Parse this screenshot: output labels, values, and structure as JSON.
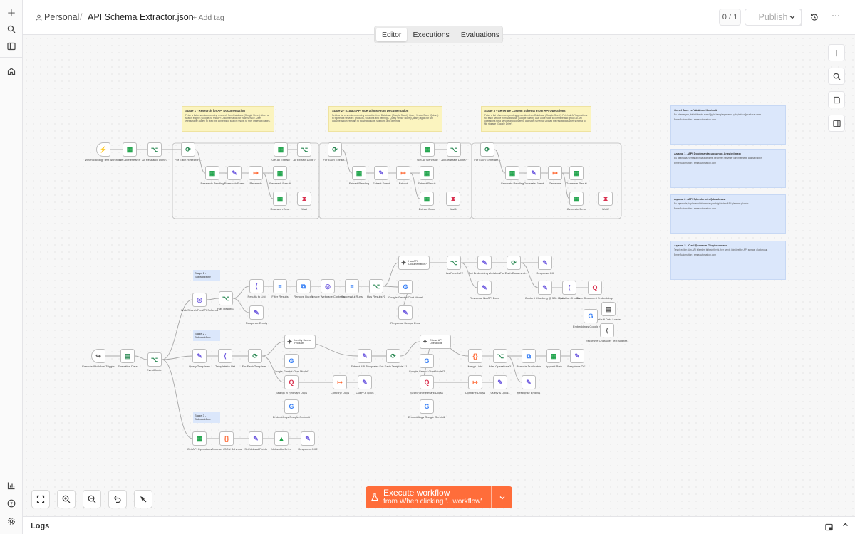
{
  "breadcrumb": {
    "workspace": "Personal",
    "separator": "/",
    "workflow_name": "API Schema Extractor.json",
    "add_tag": "+ Add tag"
  },
  "header": {
    "counter_left": "0",
    "counter_right": "1",
    "counter_text": "0 / 1",
    "publish": "Publish"
  },
  "tabs": [
    {
      "label": "Editor",
      "active": true
    },
    {
      "label": "Executions",
      "active": false
    },
    {
      "label": "Evaluations",
      "active": false
    }
  ],
  "execute": {
    "title": "Execute workflow",
    "subtitle": "from When clicking '...workflow'"
  },
  "logs": {
    "label": "Logs"
  },
  "colors": {
    "accent": "#ff6d3a",
    "sticky_yellow": "#fbf4bf",
    "sticky_blue": "#dbe7fb",
    "node_green": "#1ea34a",
    "node_purple": "#6f5be0",
    "node_red": "#d9304f"
  },
  "stickies": [
    {
      "title": "Stage 1 - Research for API Documentation",
      "text": "Fetch a list of services pending research from Database (Google Sheet). Uses a search engine (Google) to find API Documentation for each service. Uses Webscraper (Apify) to read the contents of search results to filter irrelevant pages."
    },
    {
      "title": "Stage 2 - Extract API Operations From Documentation",
      "text": "Fetch a list of services pending extraction from Database (Google Sheet). Query Vector Store (Qdrant) to figure out services' products, solutions and offerings. Query Vector Store (Qdrant) again for API documentation relevant to those products, solutions and offerings."
    },
    {
      "title": "Stage 3 - Generate Custom Schema From API Operations",
      "text": "Fetch a list of services pending generation from Database (Google Sheet). Fetch all API operations for each service from Database (Google Sheet). Use Code node to combine and group all API operations for a service and convert to a custom schema. Upload the resulting custom schema to file storage (Google Drive)."
    }
  ],
  "notes": [
    {
      "title": "Genel Akış ve Yürütme Kontrolü",
      "text": "Bu otomasyon, bir tetikleyici aracılığıyla hangi aşamanın çalıştırılacağına karar verir.",
      "link": "Emre Automation | emreautomation.com"
    },
    {
      "title": "Aşama 1 - API Dokümantasyonunun Araştırılması",
      "text": "Bu aşamada, veritabanında araştırma bekleyen servisler için internette arama yapılır.",
      "link": "Emre Automation | emreautomation.com"
    },
    {
      "title": "Aşama 2 - API İşlemlerinin Çıkarılması",
      "text": "Bu aşamada, toplanan dokümantasyon bilgisinden API işlemleri çıkarılır.",
      "link": "Emre Automation | emreautomation.com"
    },
    {
      "title": "Aşama 3 - Özel Şemanın Oluşturulması",
      "text": "Tespit edilen tüm API işlemleri birleştirilerek, her servis için özel bir API şeması oluşturulur.",
      "link": "Emre Automation | emreautomation.com"
    }
  ],
  "stage_labels": [
    "Stage 1 - Subworkflow",
    "Stage 2 - Subworkflow",
    "Stage 3 - Subworkflow"
  ],
  "nodes": [
    {
      "label": "When clicking 'Test workflow'",
      "icon": "⚡",
      "color": "#555"
    },
    {
      "label": "Get All Research",
      "icon": "▦",
      "color": "#1ea34a"
    },
    {
      "label": "All Research Done?",
      "icon": "⌥",
      "color": "#2c8a55"
    },
    {
      "label": "For Each Research...",
      "icon": "⟳",
      "color": "#2c8a55"
    },
    {
      "label": "Research Pending",
      "icon": "▦",
      "color": "#1ea34a"
    },
    {
      "label": "Research Event",
      "icon": "✎",
      "color": "#6f5be0"
    },
    {
      "label": "Research",
      "icon": "↦",
      "color": "#ff6d3a"
    },
    {
      "label": "Research Result",
      "icon": "▦",
      "color": "#1ea34a"
    },
    {
      "label": "Research Error",
      "icon": "▦",
      "color": "#1ea34a"
    },
    {
      "label": "Get All Extract",
      "icon": "▦",
      "color": "#1ea34a"
    },
    {
      "label": "All Extract Done?",
      "icon": "⌥",
      "color": "#2c8a55"
    },
    {
      "label": "Wait",
      "icon": "⧗",
      "color": "#d9304f"
    },
    {
      "label": "For Each Extract...",
      "icon": "⟳",
      "color": "#2c8a55"
    },
    {
      "label": "Extract Pending",
      "icon": "▦",
      "color": "#1ea34a"
    },
    {
      "label": "Extract Event",
      "icon": "✎",
      "color": "#6f5be0"
    },
    {
      "label": "Extract",
      "icon": "↦",
      "color": "#ff6d3a"
    },
    {
      "label": "Extract Result",
      "icon": "▦",
      "color": "#1ea34a"
    },
    {
      "label": "Extract Error",
      "icon": "▦",
      "color": "#1ea34a"
    },
    {
      "label": "Wait1",
      "icon": "⧗",
      "color": "#d9304f"
    },
    {
      "label": "Get All Generate",
      "icon": "▦",
      "color": "#1ea34a"
    },
    {
      "label": "All Generate Done?",
      "icon": "⌥",
      "color": "#2c8a55"
    },
    {
      "label": "For Each Generate...",
      "icon": "⟳",
      "color": "#2c8a55"
    },
    {
      "label": "Generate Pending",
      "icon": "▦",
      "color": "#1ea34a"
    },
    {
      "label": "Generate Event",
      "icon": "✎",
      "color": "#6f5be0"
    },
    {
      "label": "Generate",
      "icon": "↦",
      "color": "#ff6d3a"
    },
    {
      "label": "Generate Result",
      "icon": "▦",
      "color": "#1ea34a"
    },
    {
      "label": "Generate Error",
      "icon": "▦",
      "color": "#1ea34a"
    },
    {
      "label": "Wait2",
      "icon": "⧗",
      "color": "#d9304f"
    },
    {
      "label": "Execute Workflow Trigger",
      "icon": "↪",
      "color": "#444"
    },
    {
      "label": "Execution Data",
      "icon": "▤",
      "color": "#2c8a55"
    },
    {
      "label": "EventRouter",
      "icon": "⌥",
      "color": "#2c8a55"
    },
    {
      "label": "Web Search For API Schema",
      "icon": "◎",
      "color": "#6f5be0"
    },
    {
      "label": "Has Results?",
      "icon": "⌥",
      "color": "#2c8a55"
    },
    {
      "label": "Results to List",
      "icon": "⟨",
      "color": "#6f5be0"
    },
    {
      "label": "Filter Results",
      "icon": "≡",
      "color": "#3b82f6"
    },
    {
      "label": "Remove Dupes",
      "icon": "⧉",
      "color": "#3b82f6"
    },
    {
      "label": "Scrape Webpage Contents",
      "icon": "◎",
      "color": "#6f5be0"
    },
    {
      "label": "Successful Runs",
      "icon": "≡",
      "color": "#3b82f6"
    },
    {
      "label": "Has Results?1",
      "icon": "⌥",
      "color": "#2c8a55"
    },
    {
      "label": "Response Empty",
      "icon": "✎",
      "color": "#6f5be0"
    },
    {
      "label": "Has API Documentation?",
      "icon": "✦",
      "color": "#555"
    },
    {
      "label": "Google Gemini Chat Model",
      "icon": "G",
      "color": "#3b82f6"
    },
    {
      "label": "Response Scrape Error",
      "icon": "✎",
      "color": "#6f5be0"
    },
    {
      "label": "Has Results?2",
      "icon": "⌥",
      "color": "#2c8a55"
    },
    {
      "label": "Set Embedding Variables",
      "icon": "✎",
      "color": "#6f5be0"
    },
    {
      "label": "For Each Document...",
      "icon": "⟳",
      "color": "#2c8a55"
    },
    {
      "label": "Response OK",
      "icon": "✎",
      "color": "#6f5be0"
    },
    {
      "label": "Response No API Docs",
      "icon": "✎",
      "color": "#6f5be0"
    },
    {
      "label": "Content Chunking @ 50k Chars",
      "icon": "✎",
      "color": "#6f5be0"
    },
    {
      "label": "Split Out Chunks",
      "icon": "⟨",
      "color": "#6f5be0"
    },
    {
      "label": "Store Document Embeddings",
      "icon": "Q",
      "color": "#d9304f"
    },
    {
      "label": "Default Data Loader",
      "icon": "▤",
      "color": "#555"
    },
    {
      "label": "Embeddings Google Gemini",
      "icon": "G",
      "color": "#3b82f6"
    },
    {
      "label": "Recursive Character Text Splitter1",
      "icon": "⟨",
      "color": "#555"
    },
    {
      "label": "Query Templates",
      "icon": "✎",
      "color": "#6f5be0"
    },
    {
      "label": "Template to List",
      "icon": "⟨",
      "color": "#6f5be0"
    },
    {
      "label": "For Each Template...",
      "icon": "⟳",
      "color": "#2c8a55"
    },
    {
      "label": "Identify Service Products",
      "icon": "✦",
      "color": "#555"
    },
    {
      "label": "Google Gemini Chat Model1",
      "icon": "G",
      "color": "#3b82f6"
    },
    {
      "label": "Search in Relevant Docs",
      "icon": "Q",
      "color": "#d9304f"
    },
    {
      "label": "Embeddings Google Gemini1",
      "icon": "G",
      "color": "#3b82f6"
    },
    {
      "label": "Combine Docs",
      "icon": "↦",
      "color": "#ff6d3a"
    },
    {
      "label": "Query & Docs",
      "icon": "✎",
      "color": "#6f5be0"
    },
    {
      "label": "Extract API Templates",
      "icon": "✎",
      "color": "#6f5be0"
    },
    {
      "label": "For Each Template...1",
      "icon": "⟳",
      "color": "#2c8a55"
    },
    {
      "label": "Extract API Operations",
      "icon": "✦",
      "color": "#555"
    },
    {
      "label": "Google Gemini Chat Model2",
      "icon": "G",
      "color": "#3b82f6"
    },
    {
      "label": "Search in Relevant Docs1",
      "icon": "Q",
      "color": "#d9304f"
    },
    {
      "label": "Embeddings Google Gemini2",
      "icon": "G",
      "color": "#3b82f6"
    },
    {
      "label": "Combine Docs1",
      "icon": "↦",
      "color": "#ff6d3a"
    },
    {
      "label": "Query & Docs1",
      "icon": "✎",
      "color": "#6f5be0"
    },
    {
      "label": "Merge Lists",
      "icon": "{}",
      "color": "#ff6d3a"
    },
    {
      "label": "Has Operations?",
      "icon": "⌥",
      "color": "#2c8a55"
    },
    {
      "label": "Remove Duplicates",
      "icon": "⧉",
      "color": "#3b82f6"
    },
    {
      "label": "Append Row",
      "icon": "▦",
      "color": "#1ea34a"
    },
    {
      "label": "Response OK1",
      "icon": "✎",
      "color": "#6f5be0"
    },
    {
      "label": "Response Empty1",
      "icon": "✎",
      "color": "#6f5be0"
    },
    {
      "label": "Get API Operations",
      "icon": "▦",
      "color": "#1ea34a"
    },
    {
      "label": "Contruct JSON Schema",
      "icon": "{}",
      "color": "#ff6d3a"
    },
    {
      "label": "Set Upload Fields",
      "icon": "✎",
      "color": "#6f5be0"
    },
    {
      "label": "Upload to Drive",
      "icon": "▲",
      "color": "#1ea34a"
    },
    {
      "label": "Response OK2",
      "icon": "✎",
      "color": "#6f5be0"
    }
  ]
}
